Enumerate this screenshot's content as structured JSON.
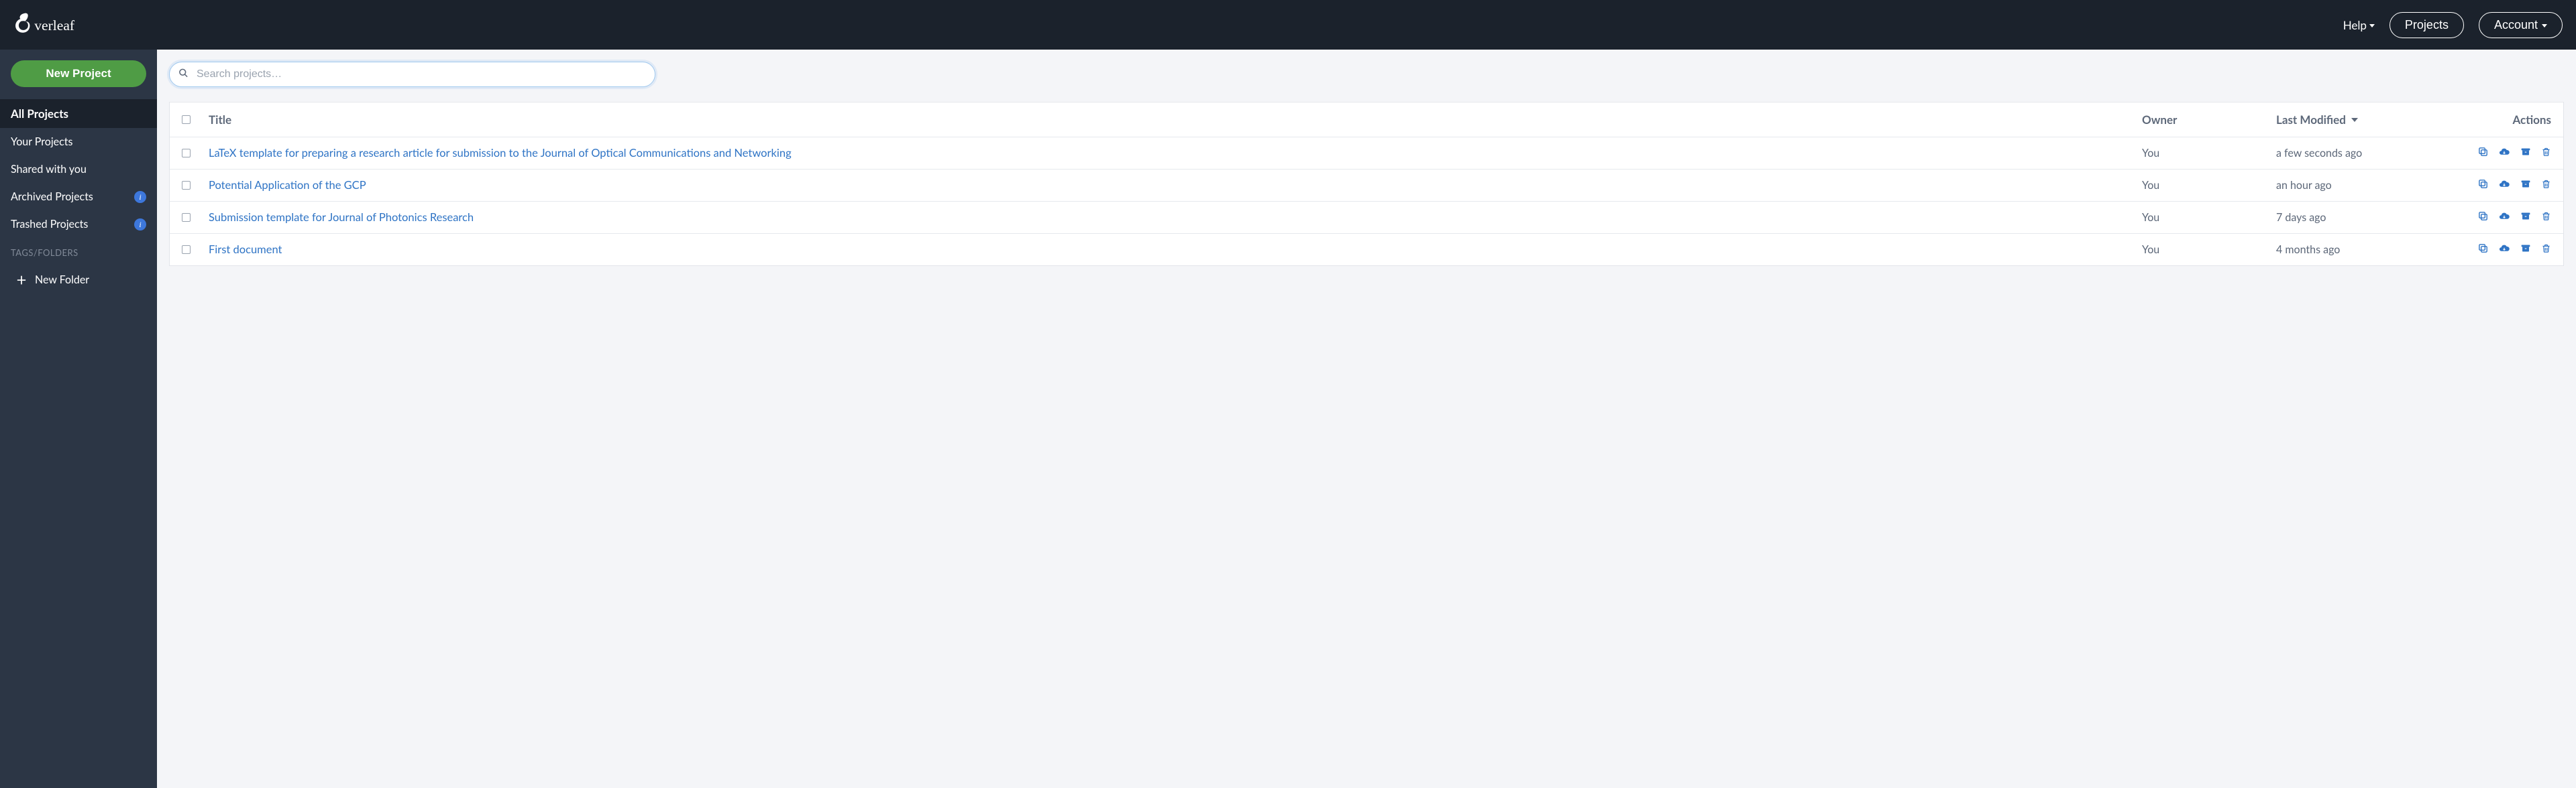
{
  "colors": {
    "accent_green": "#4f9c45",
    "link": "#2f74c5",
    "header_bg": "#1b222c",
    "sidebar_bg": "#2c3645"
  },
  "topbar": {
    "help": "Help",
    "projects": "Projects",
    "account": "Account"
  },
  "sidebar": {
    "new_project": "New Project",
    "items": [
      {
        "label": "All Projects",
        "active": true
      },
      {
        "label": "Your Projects"
      },
      {
        "label": "Shared with you"
      },
      {
        "label": "Archived Projects",
        "info": true
      },
      {
        "label": "Trashed Projects",
        "info": true
      }
    ],
    "tags_label": "TAGS/FOLDERS",
    "new_folder": "New Folder"
  },
  "search": {
    "placeholder": "Search projects…"
  },
  "table": {
    "headers": {
      "title": "Title",
      "owner": "Owner",
      "last_modified": "Last Modified",
      "actions": "Actions"
    },
    "rows": [
      {
        "title": "LaTeX template for preparing a research article for submission to the Journal of Optical Communications and Networking",
        "owner": "You",
        "modified": "a few seconds ago"
      },
      {
        "title": "Potential Application of the GCP",
        "owner": "You",
        "modified": "an hour ago"
      },
      {
        "title": "Submission template for Journal of Photonics Research",
        "owner": "You",
        "modified": "7 days ago"
      },
      {
        "title": "First document",
        "owner": "You",
        "modified": "4 months ago"
      }
    ]
  },
  "icons": {
    "copy": "copy-icon",
    "download": "cloud-download-icon",
    "archive": "archive-icon",
    "trash": "trash-icon"
  }
}
